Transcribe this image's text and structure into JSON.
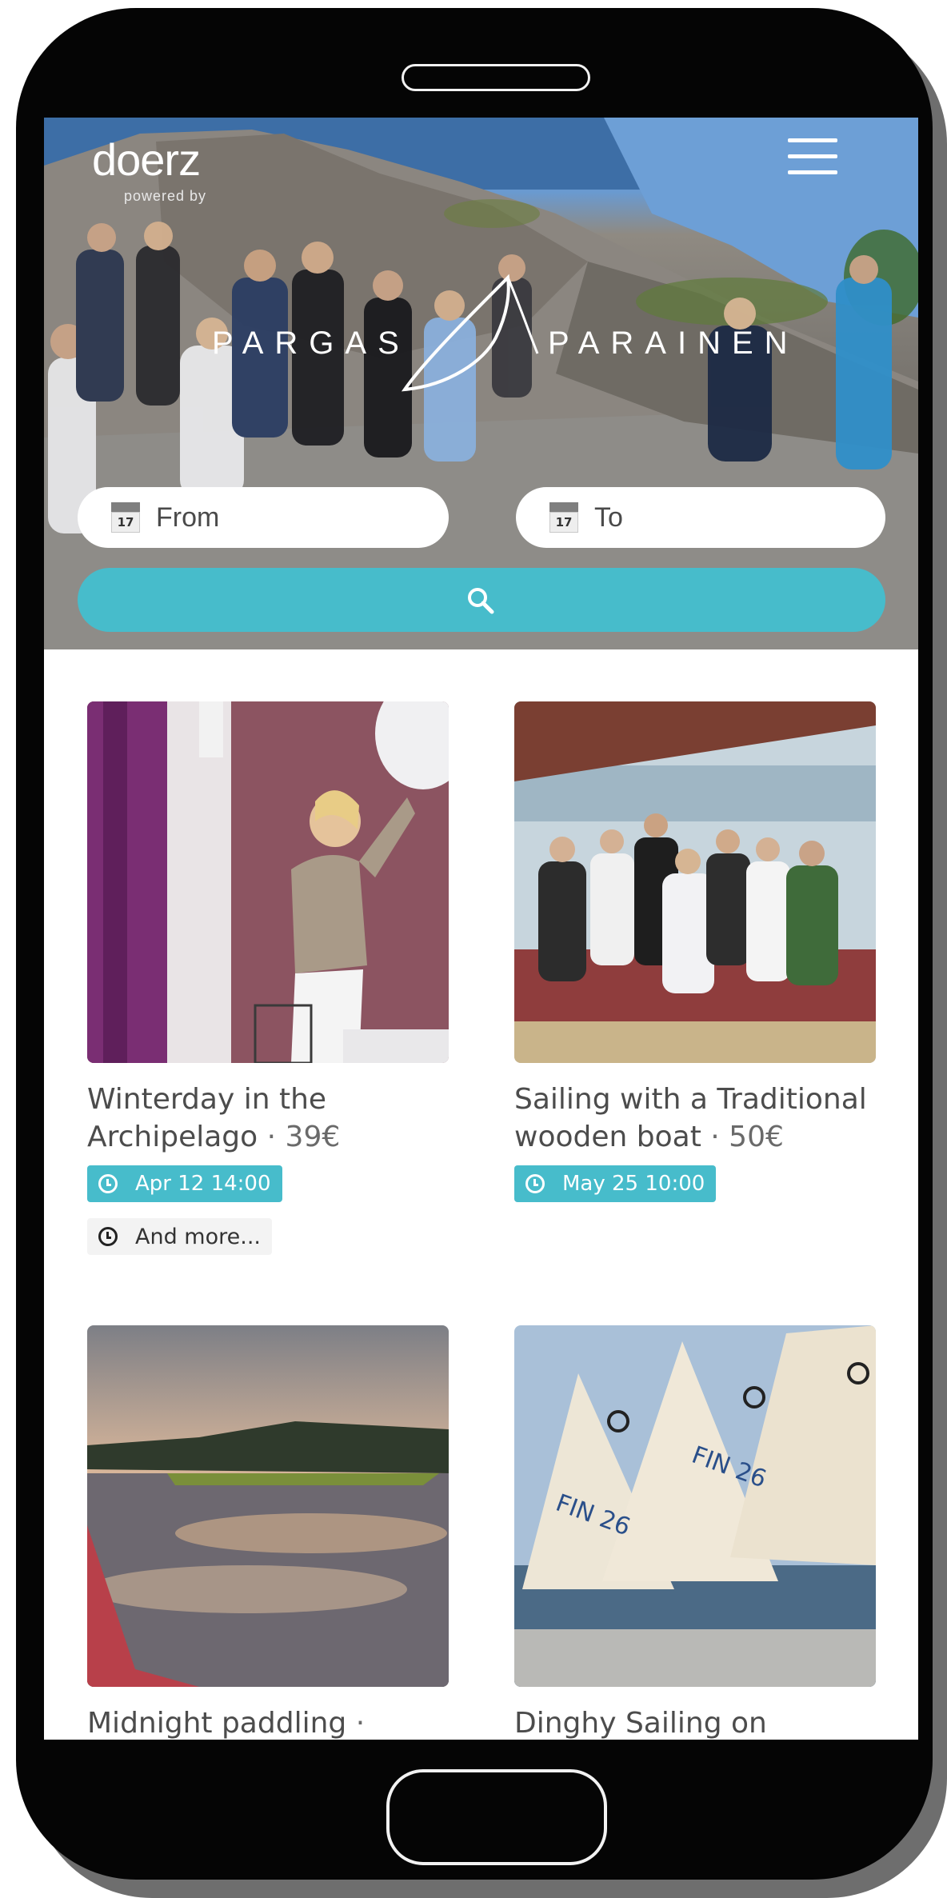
{
  "header": {
    "logo": "doerz",
    "logo_sub": "powered by",
    "menu_icon": "hamburger-menu-icon"
  },
  "hero": {
    "brand_left": "PARGAS",
    "brand_right": "PARAINEN",
    "from_placeholder": "From",
    "to_placeholder": "To",
    "calendar_day": "17",
    "search_icon": "search-icon"
  },
  "colors": {
    "accent": "#47bccb",
    "frame": "#050505"
  },
  "cards": [
    {
      "title": "Winterday in the Archipelago",
      "price": "39€",
      "date": "Apr 12 14:00",
      "more": "And more..."
    },
    {
      "title": "Sailing with a Traditional wooden boat",
      "price": "50€",
      "date": "May 25 10:00"
    },
    {
      "title": "Midnight paddling",
      "price": ""
    },
    {
      "title": "Dinghy Sailing on",
      "price": ""
    }
  ],
  "separator": "·"
}
